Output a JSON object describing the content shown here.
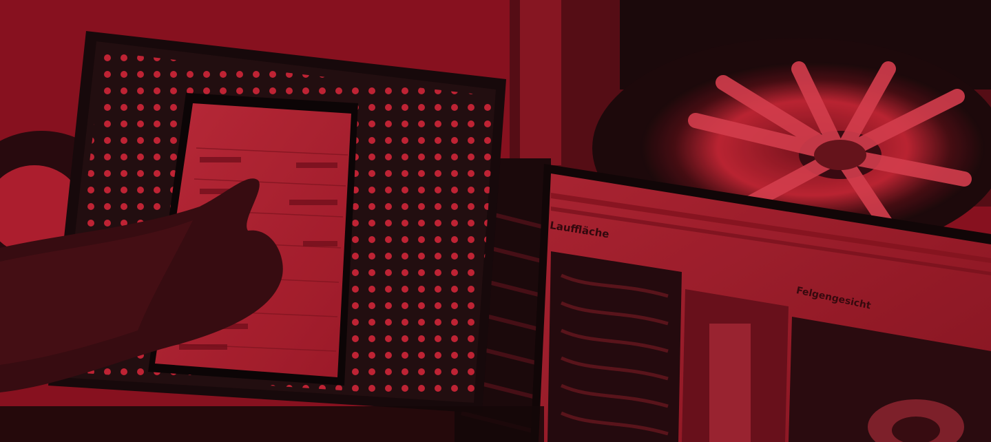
{
  "photo": {
    "label_tread": "Lauffläche",
    "label_rim_face": "Felgengesicht",
    "tint_color": "#a8182a",
    "subject": "photo-of-tire-inspection-equipment"
  }
}
